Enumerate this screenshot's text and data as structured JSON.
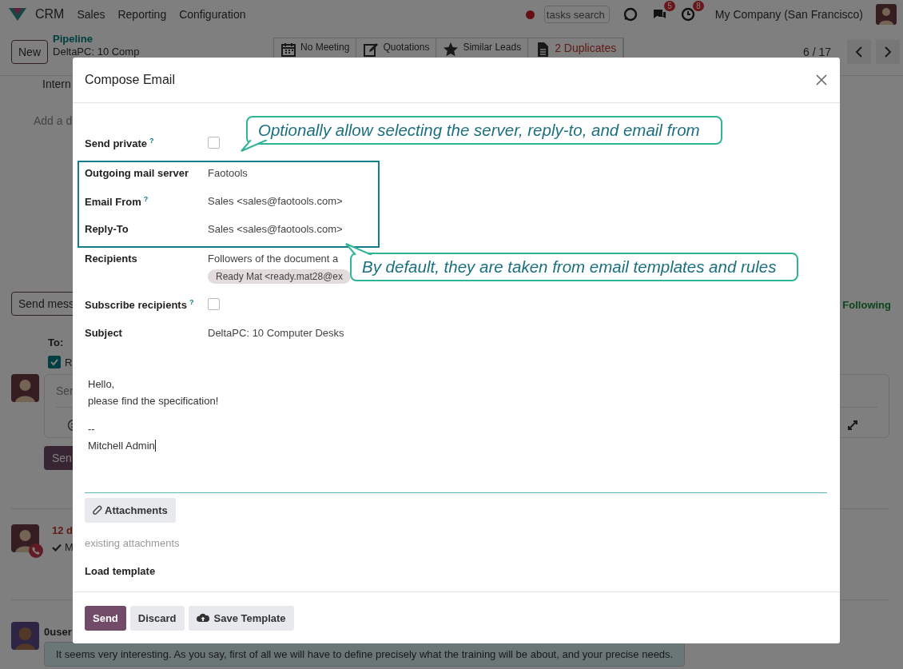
{
  "navbar": {
    "app": "CRM",
    "menu": [
      "Sales",
      "Reporting",
      "Configuration"
    ],
    "search": {
      "placeholder": "tasks search"
    },
    "messages_badge": "5",
    "activities_badge": "8",
    "company": "My Company (San Francisco)"
  },
  "control_panel": {
    "new_button": "New",
    "breadcrumb": "Pipeline",
    "record": "DeltaPC: 10 Comp",
    "smart_buttons": [
      {
        "kind": "calendar",
        "label": "No Meeting",
        "alert": false
      },
      {
        "kind": "edit",
        "label": "Quotations",
        "alert": false
      },
      {
        "kind": "star",
        "label": "Similar Leads",
        "alert": false
      },
      {
        "kind": "file",
        "label": "2 Duplicates",
        "alert": true
      }
    ],
    "pager": "6 / 17"
  },
  "chatter": {
    "note_field": "Intern",
    "description_placeholder": "Add a d",
    "send_button": "Send mess",
    "follow": "Following",
    "to_label": "To:",
    "recipient": {
      "checked": true,
      "label": "R"
    },
    "composer_placeholder": "Ser",
    "composer_send": "Sen",
    "activity": {
      "date": "12 d",
      "summary": "M"
    },
    "message": {
      "author": "0user",
      "body": "It seems very interesting. As you say, first of all we will have to define precisely what the training will be about, and your precise needs."
    }
  },
  "dialog": {
    "title": "Compose Email",
    "fields": [
      {
        "kind": "checkbox",
        "label": "Send private",
        "help": "?",
        "checked": false,
        "highlighted": false
      },
      {
        "kind": "text",
        "label": "Outgoing mail server",
        "value": "Faotools",
        "highlighted": true
      },
      {
        "kind": "text",
        "label": "Email From",
        "help": "?",
        "value": "Sales <sales@faotools.com>",
        "highlighted": true
      },
      {
        "kind": "text",
        "label": "Reply-To",
        "value": "Sales <sales@faotools.com>",
        "highlighted": true
      },
      {
        "kind": "tags",
        "label": "Recipients",
        "value": "Followers of the document a",
        "tags": [
          "Ready Mat <ready.mat28@ex"
        ],
        "highlighted": false
      },
      {
        "kind": "checkbox",
        "label": "Subscribe recipients",
        "help": "?",
        "checked": false,
        "highlighted": false
      },
      {
        "kind": "text",
        "label": "Subject",
        "value": "DeltaPC: 10 Computer Desks",
        "highlighted": false
      }
    ],
    "body": [
      [
        "Hello,",
        "please find the specification!"
      ],
      [
        "--",
        "Mitchell Admin"
      ]
    ],
    "attachments_button": "Attachments",
    "attachments_placeholder": "existing attachments",
    "load_template": "Load template",
    "buttons": [
      {
        "kind": "primary",
        "label": "Send"
      },
      {
        "kind": "plain",
        "label": "Discard"
      },
      {
        "kind": "upload",
        "label": "Save Template"
      }
    ]
  },
  "callouts": [
    {
      "kind": "down",
      "text": "Optionally allow selecting the server, reply-to, and email from"
    },
    {
      "kind": "up",
      "text": "By default, they are taken from email templates and rules"
    }
  ]
}
